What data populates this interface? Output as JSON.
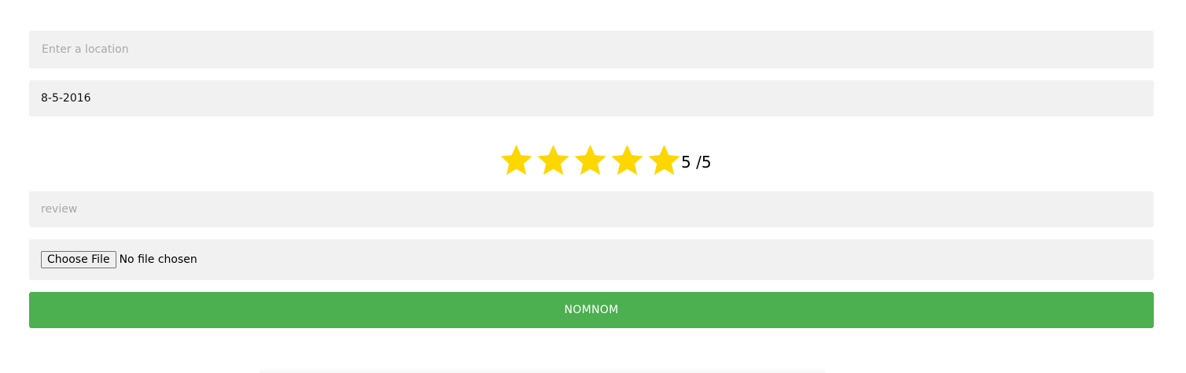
{
  "form": {
    "location": {
      "placeholder": "Enter a location",
      "value": ""
    },
    "date": {
      "value": "8-5-2016"
    },
    "rating": {
      "value": 5,
      "max": 5,
      "label": "5 /5",
      "star_icon": "star-icon",
      "star_color": "#ffd700"
    },
    "review": {
      "placeholder": "review",
      "value": ""
    },
    "file": {
      "button_label": "Choose File",
      "status": "No file chosen"
    },
    "submit": {
      "label": "NOMNOM",
      "color": "#4caf50"
    }
  }
}
